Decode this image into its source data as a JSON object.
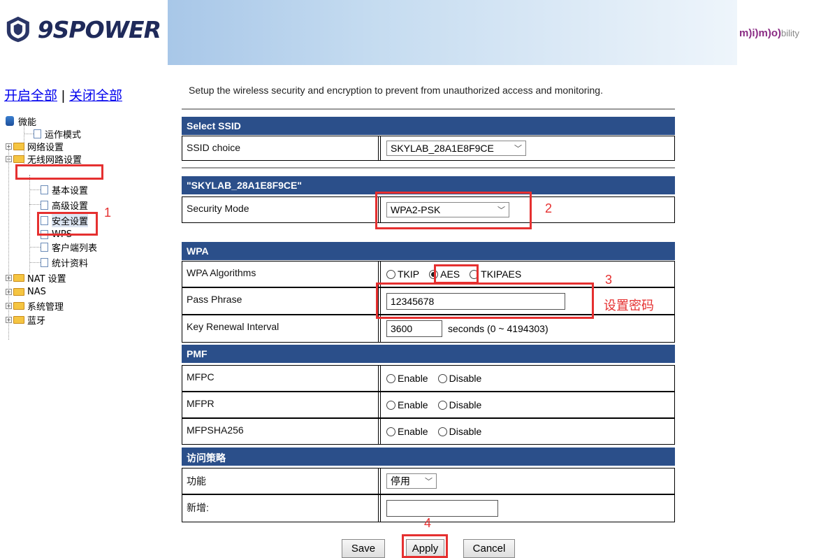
{
  "brand": {
    "logo_text": "9SPOWER",
    "partner_logo": {
      "part1": "m)i)m)o)",
      "part2": "bility"
    }
  },
  "sidebar": {
    "open_all": "开启全部",
    "separator": "|",
    "close_all": "关闭全部",
    "tree": [
      {
        "label": "微能"
      },
      {
        "label": "运作模式"
      },
      {
        "label": "网络设置"
      },
      {
        "label": "无线网路设置"
      },
      {
        "label": "基本设置"
      },
      {
        "label": "高级设置"
      },
      {
        "label": "安全设置"
      },
      {
        "label": "WPS"
      },
      {
        "label": "客户端列表"
      },
      {
        "label": "统计资料"
      },
      {
        "label": "NAT 设置"
      },
      {
        "label": "NAS"
      },
      {
        "label": "系统管理"
      },
      {
        "label": "蓝牙"
      }
    ]
  },
  "main": {
    "description": "Setup the wireless security and encryption to prevent from unauthorized access and monitoring.",
    "select_ssid": {
      "header": "Select SSID",
      "label": "SSID choice",
      "value": "SKYLAB_28A1E8F9CE"
    },
    "ssid_section": {
      "header": "\"SKYLAB_28A1E8F9CE\"",
      "security_label": "Security Mode",
      "security_value": "WPA2-PSK"
    },
    "wpa": {
      "header": "WPA",
      "algorithms_label": "WPA Algorithms",
      "algorithms": [
        "TKIP",
        "AES",
        "TKIPAES"
      ],
      "selected_algorithm": "AES",
      "passphrase_label": "Pass Phrase",
      "passphrase_value": "12345678",
      "renewal_label": "Key Renewal Interval",
      "renewal_value": "3600",
      "renewal_unit": "seconds  (0 ~ 4194303)"
    },
    "pmf": {
      "header": "PMF",
      "rows": [
        {
          "label": "MFPC",
          "enable": "Enable",
          "disable": "Disable"
        },
        {
          "label": "MFPR",
          "enable": "Enable",
          "disable": "Disable"
        },
        {
          "label": "MFPSHA256",
          "enable": "Enable",
          "disable": "Disable"
        }
      ]
    },
    "access": {
      "header": "访问策略",
      "function_label": "功能",
      "function_value": "停用",
      "add_label": "新增:",
      "add_value": ""
    },
    "buttons": {
      "save": "Save",
      "apply": "Apply",
      "cancel": "Cancel"
    }
  },
  "annotations": {
    "n1": "1",
    "n2": "2",
    "n3": "3",
    "n3_text": "设置密码",
    "n4": "4",
    "color": "#e53030"
  }
}
